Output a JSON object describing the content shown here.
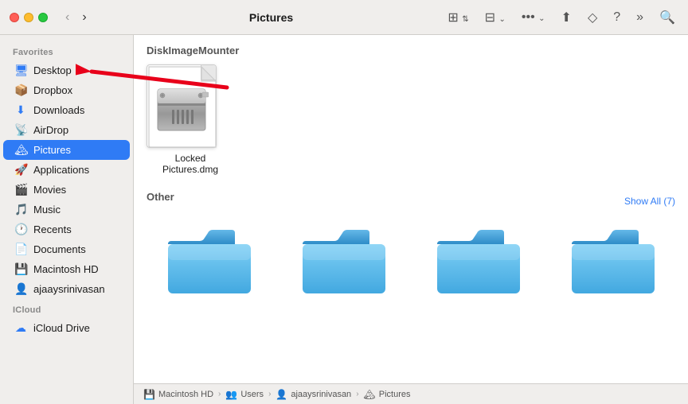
{
  "window": {
    "title": "Pictures"
  },
  "toolbar": {
    "back_label": "‹",
    "forward_label": "›",
    "view_icon": "⊞",
    "grid_icon": "⊟",
    "more_icon": "•••",
    "share_icon": "↑",
    "tag_icon": "◇",
    "help_icon": "?",
    "extend_icon": "»",
    "search_icon": "⌕"
  },
  "sidebar": {
    "favorites_label": "Favorites",
    "items": [
      {
        "id": "desktop",
        "label": "Desktop",
        "icon": "🖥",
        "active": false
      },
      {
        "id": "dropbox",
        "label": "Dropbox",
        "icon": "📦",
        "active": false
      },
      {
        "id": "downloads",
        "label": "Downloads",
        "icon": "⬇",
        "active": false
      },
      {
        "id": "airdrop",
        "label": "AirDrop",
        "icon": "📡",
        "active": false
      },
      {
        "id": "pictures",
        "label": "Pictures",
        "icon": "🏔",
        "active": true
      },
      {
        "id": "applications",
        "label": "Applications",
        "icon": "🚀",
        "active": false
      },
      {
        "id": "movies",
        "label": "Movies",
        "icon": "🎬",
        "active": false
      },
      {
        "id": "music",
        "label": "Music",
        "icon": "🎵",
        "active": false
      },
      {
        "id": "recents",
        "label": "Recents",
        "icon": "🕐",
        "active": false
      },
      {
        "id": "documents",
        "label": "Documents",
        "icon": "📄",
        "active": false
      },
      {
        "id": "macintosh-hd",
        "label": "Macintosh HD",
        "icon": "💾",
        "active": false
      },
      {
        "id": "user",
        "label": "ajaaysrinivasan",
        "icon": "👤",
        "active": false
      }
    ],
    "icloud_label": "iCloud",
    "icloud_items": [
      {
        "id": "icloud-drive",
        "label": "iCloud Drive",
        "icon": "☁",
        "active": false
      }
    ]
  },
  "disk_section": {
    "title": "DiskImageMounter",
    "file_label": "Locked Pictures.dmg"
  },
  "other_section": {
    "title": "Other",
    "show_all": "Show All (7)",
    "folders": [
      {
        "id": "folder-1"
      },
      {
        "id": "folder-2"
      },
      {
        "id": "folder-3"
      },
      {
        "id": "folder-4"
      }
    ]
  },
  "status_bar": {
    "items": [
      {
        "icon": "💾",
        "label": "Macintosh HD"
      },
      {
        "icon": "👥",
        "label": "Users"
      },
      {
        "icon": "👤",
        "label": "ajaaysrinivasan"
      },
      {
        "icon": "🏔",
        "label": "Pictures"
      }
    ]
  }
}
